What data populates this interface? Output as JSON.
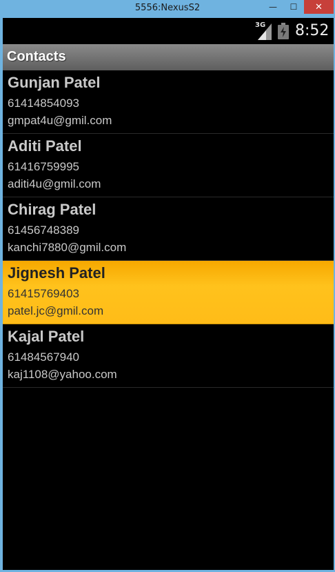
{
  "window": {
    "title": "5556:NexusS2",
    "minimize_glyph": "—",
    "maximize_glyph": "☐",
    "close_glyph": "✕"
  },
  "statusbar": {
    "network": "3G",
    "time": "8:52",
    "icons": [
      "signal-icon",
      "battery-charging-icon"
    ]
  },
  "app": {
    "title": "Contacts"
  },
  "contacts": [
    {
      "name": "Gunjan Patel",
      "phone": "61414854093",
      "email": "gmpat4u@gmil.com",
      "selected": false
    },
    {
      "name": "Aditi Patel",
      "phone": "61416759995",
      "email": "aditi4u@gmil.com",
      "selected": false
    },
    {
      "name": "Chirag Patel",
      "phone": "61456748389",
      "email": "kanchi7880@gmil.com",
      "selected": false
    },
    {
      "name": "Jignesh Patel",
      "phone": "61415769403",
      "email": "patel.jc@gmil.com",
      "selected": true
    },
    {
      "name": "Kajal Patel",
      "phone": "61484567940",
      "email": "kaj1108@yahoo.com",
      "selected": false
    }
  ],
  "colors": {
    "selected_row": "#ffbc18",
    "close_button": "#c7403a",
    "window_frame": "#6fb3e0"
  }
}
